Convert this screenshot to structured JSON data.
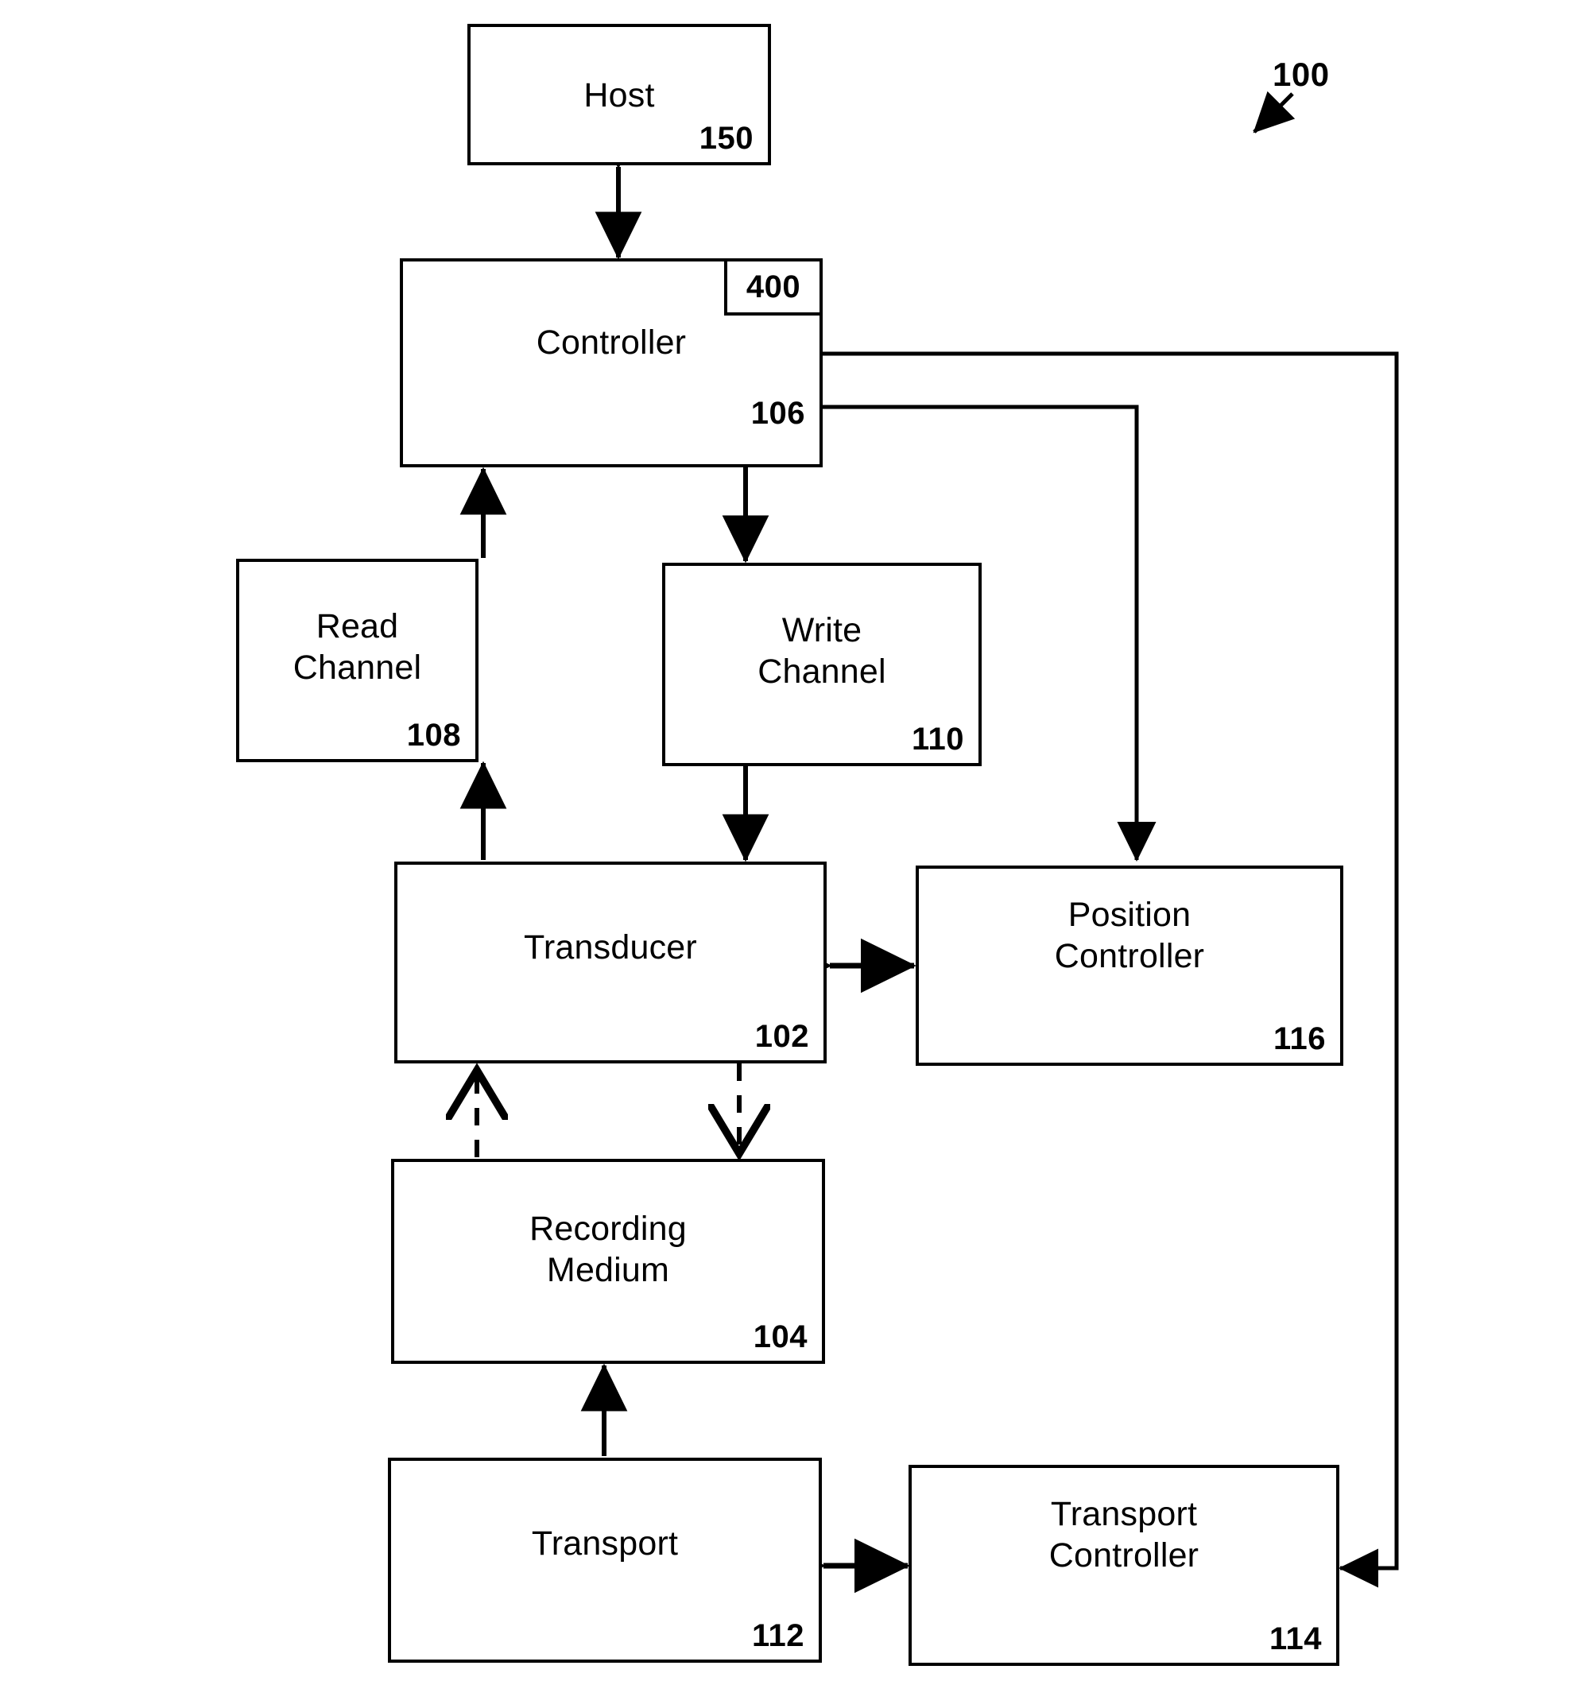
{
  "figure": {
    "callout": {
      "label": "100"
    },
    "nodes": [
      {
        "id": "host",
        "label": "Host",
        "ref": "150"
      },
      {
        "id": "controller",
        "label": "Controller",
        "ref": "106",
        "sub_ref": "400"
      },
      {
        "id": "read-channel",
        "label": "Read\nChannel",
        "ref": "108"
      },
      {
        "id": "write-channel",
        "label": "Write\nChannel",
        "ref": "110"
      },
      {
        "id": "transducer",
        "label": "Transducer",
        "ref": "102"
      },
      {
        "id": "position-controller",
        "label": "Position\nController",
        "ref": "116"
      },
      {
        "id": "recording-medium",
        "label": "Recording\nMedium",
        "ref": "104"
      },
      {
        "id": "transport",
        "label": "Transport",
        "ref": "112"
      },
      {
        "id": "transport-controller",
        "label": "Transport\nController",
        "ref": "114"
      }
    ],
    "connections": [
      {
        "from": "host",
        "to": "controller",
        "style": "solid",
        "arrows": "both"
      },
      {
        "from": "read-channel",
        "to": "controller",
        "style": "solid",
        "arrows": "end"
      },
      {
        "from": "controller",
        "to": "write-channel",
        "style": "solid",
        "arrows": "end"
      },
      {
        "from": "controller",
        "to": "position-controller",
        "style": "solid",
        "arrows": "end"
      },
      {
        "from": "controller",
        "to": "transport-controller",
        "style": "solid",
        "arrows": "end"
      },
      {
        "from": "transducer",
        "to": "read-channel",
        "style": "solid",
        "arrows": "end"
      },
      {
        "from": "write-channel",
        "to": "transducer",
        "style": "solid",
        "arrows": "end"
      },
      {
        "from": "transducer",
        "to": "position-controller",
        "style": "solid",
        "arrows": "both"
      },
      {
        "from": "recording-medium",
        "to": "transducer",
        "style": "dashed",
        "arrows": "end"
      },
      {
        "from": "transducer",
        "to": "recording-medium",
        "style": "dashed",
        "arrows": "end"
      },
      {
        "from": "transport",
        "to": "recording-medium",
        "style": "solid",
        "arrows": "end"
      },
      {
        "from": "transport",
        "to": "transport-controller",
        "style": "solid",
        "arrows": "both"
      }
    ]
  },
  "colors": {
    "ink": "#000000",
    "paper": "#ffffff"
  }
}
